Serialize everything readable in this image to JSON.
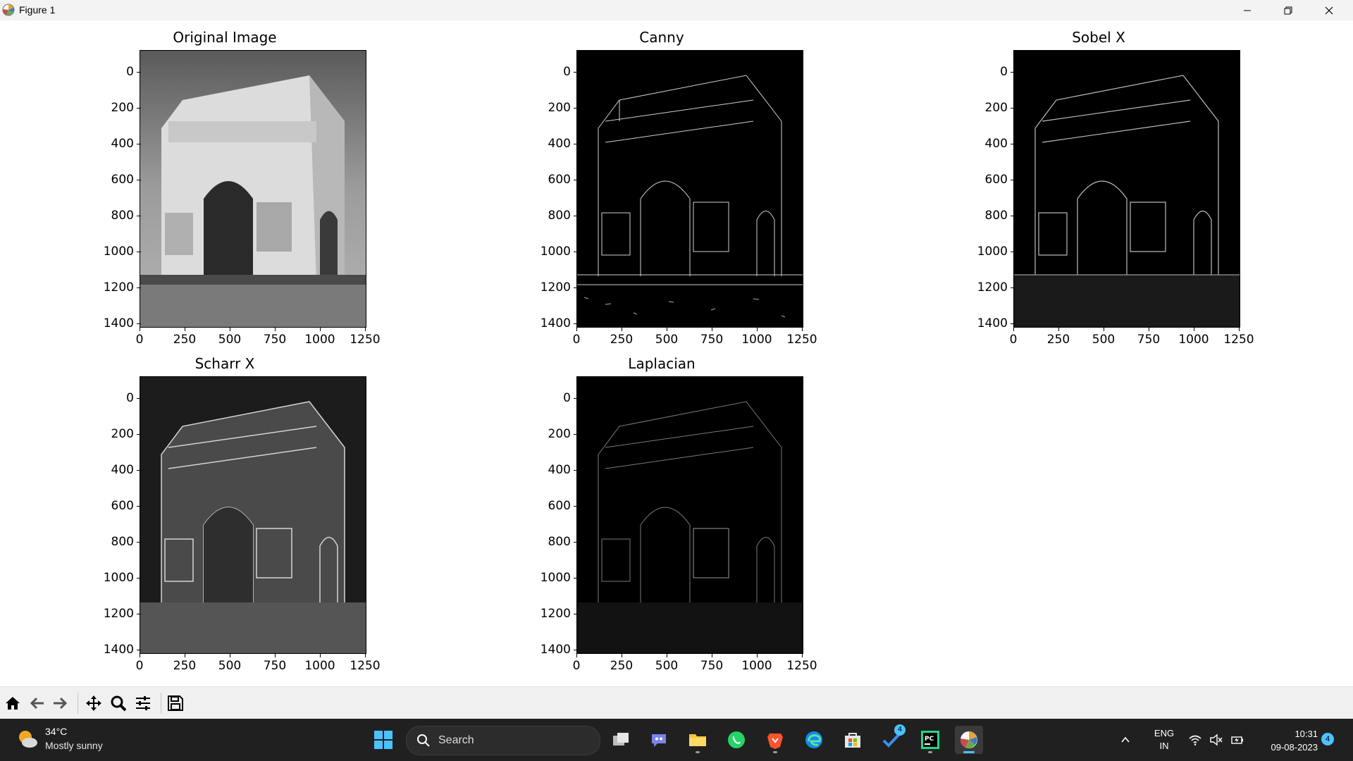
{
  "window": {
    "title": "Figure 1",
    "icons": [
      "matplotlib-icon",
      "minimize-icon",
      "maximize-icon",
      "close-icon"
    ]
  },
  "subplots": [
    {
      "title": "Original Image",
      "style": "original"
    },
    {
      "title": "Canny",
      "style": "edges"
    },
    {
      "title": "Sobel X",
      "style": "edges"
    },
    {
      "title": "Scharr X",
      "style": "scharr"
    },
    {
      "title": "Laplacian",
      "style": "laplacian"
    }
  ],
  "axis_ticks": {
    "y": [
      "0",
      "200",
      "400",
      "600",
      "800",
      "1000",
      "1200",
      "1400"
    ],
    "x": [
      "0",
      "250",
      "500",
      "750",
      "1000",
      "1250"
    ]
  },
  "toolbar": {
    "icons": [
      "home-icon",
      "back-icon",
      "forward-icon",
      "pan-icon",
      "zoom-icon",
      "configure-subplots-icon",
      "save-icon"
    ]
  },
  "taskbar": {
    "weather": {
      "temp": "34°C",
      "desc": "Mostly sunny"
    },
    "search_placeholder": "Search",
    "lang_line1": "ENG",
    "lang_line2": "IN",
    "time": "10:31",
    "date": "09-08-2023",
    "notification_count": "4",
    "app_badge": "4"
  },
  "colors": {
    "taskbar_bg": "#202020",
    "toolbar_bg": "#f0f0f0",
    "accent": "#4cc2ff"
  }
}
